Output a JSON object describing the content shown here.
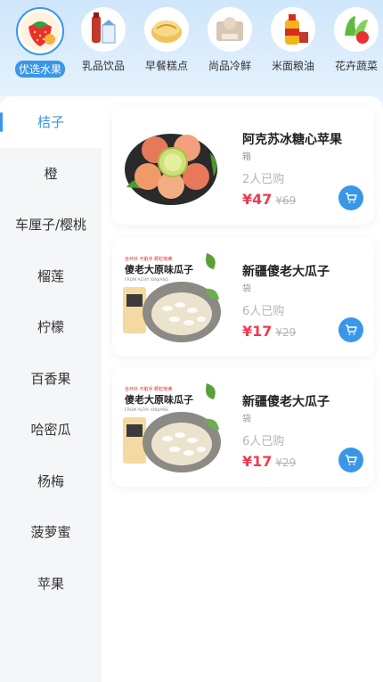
{
  "categories": [
    {
      "label": "优选水果",
      "icon": "strawberry-icon",
      "active": true
    },
    {
      "label": "乳品饮品",
      "icon": "milk-drinks-icon",
      "active": false
    },
    {
      "label": "早餐糕点",
      "icon": "pastry-icon",
      "active": false
    },
    {
      "label": "尚品冷鲜",
      "icon": "frozen-icon",
      "active": false
    },
    {
      "label": "米面粮油",
      "icon": "oil-grain-icon",
      "active": false
    },
    {
      "label": "花卉蔬菜",
      "icon": "vegetable-icon",
      "active": false
    }
  ],
  "sidebar": {
    "items": [
      {
        "label": "桔子",
        "active": true
      },
      {
        "label": "橙"
      },
      {
        "label": "车厘子/樱桃"
      },
      {
        "label": "榴莲"
      },
      {
        "label": "柠檬"
      },
      {
        "label": "百香果"
      },
      {
        "label": "哈密瓜"
      },
      {
        "label": "杨梅"
      },
      {
        "label": "菠萝蜜"
      },
      {
        "label": "苹果"
      }
    ]
  },
  "products": [
    {
      "title": "阿克苏冰糖心苹果",
      "unit": "箱",
      "sold": "2人已购",
      "price": "¥47",
      "original_price": "¥69",
      "image": "apples-image"
    },
    {
      "title": "新疆傻老大瓜子",
      "unit": "袋",
      "sold": "6人已购",
      "price": "¥17",
      "original_price": "¥29",
      "image": "sunflower-seeds-image",
      "image_text": {
        "line1": "全坏补  不脏手  颗粒饱满",
        "line2": "傻老大原味瓜子",
        "line3": "FROM ALTAY XINJIANG"
      }
    },
    {
      "title": "新疆傻老大瓜子",
      "unit": "袋",
      "sold": "6人已购",
      "price": "¥17",
      "original_price": "¥29",
      "image": "sunflower-seeds-image",
      "image_text": {
        "line1": "全坏补  不脏手  颗粒饱满",
        "line2": "傻老大原味瓜子",
        "line3": "FROM ALTAY XINJIANG"
      }
    }
  ],
  "colors": {
    "accent": "#3a96e8",
    "price": "#f0394e"
  }
}
